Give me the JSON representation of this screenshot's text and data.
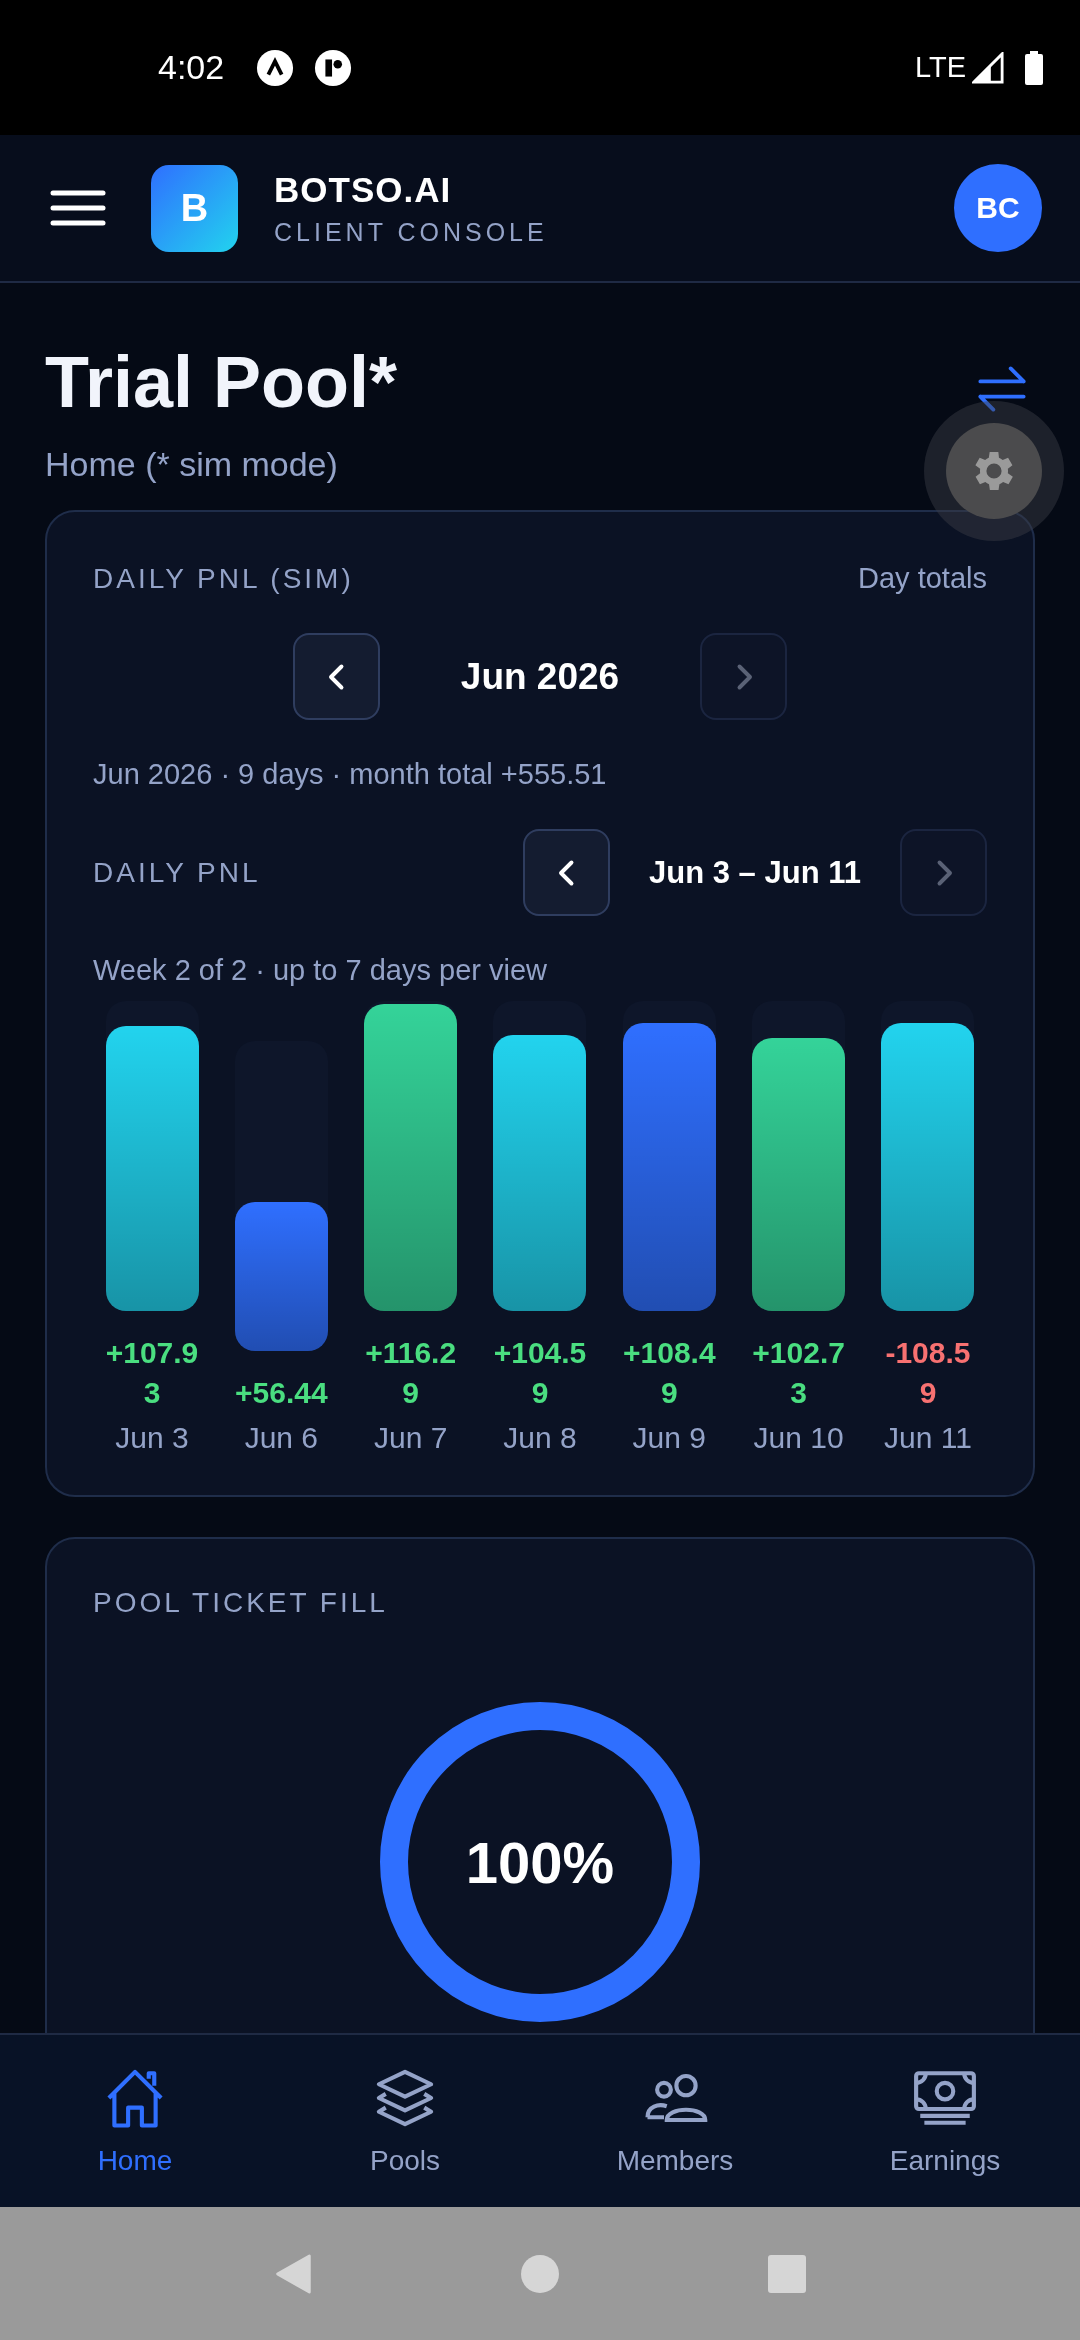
{
  "status_bar": {
    "time": "4:02",
    "network": "LTE"
  },
  "header": {
    "logo_letter": "B",
    "brand": "BOTSO.AI",
    "subtitle": "CLIENT CONSOLE",
    "avatar": "BC"
  },
  "page": {
    "title": "Trial Pool*",
    "subtitle": "Home (* sim mode)"
  },
  "pnl_card": {
    "title": "DAILY PNL (SIM)",
    "note": "Day totals",
    "month_nav": {
      "label": "Jun 2026",
      "prev_disabled": false,
      "next_disabled": true
    },
    "summary": "Jun 2026 · 9 days · month total +555.51",
    "week_nav": {
      "title": "DAILY PNL",
      "label": "Jun 3 – Jun 11",
      "prev_disabled": false,
      "next_disabled": true
    },
    "caption": "Week 2 of 2 · up to 7 days per view",
    "days": [
      {
        "label": "Jun 3",
        "value": "+107.93",
        "loss": false,
        "color": "#22d3ee",
        "level": 0.92
      },
      {
        "label": "Jun 6",
        "value": "+56.44",
        "loss": false,
        "color": "#2f6fff",
        "level": 0.48
      },
      {
        "label": "Jun 7",
        "value": "+116.29",
        "loss": false,
        "color": "#34d399",
        "level": 0.99
      },
      {
        "label": "Jun 8",
        "value": "+104.59",
        "loss": false,
        "color": "#22d3ee",
        "level": 0.89
      },
      {
        "label": "Jun 9",
        "value": "+108.49",
        "loss": false,
        "color": "#2f6fff",
        "level": 0.93
      },
      {
        "label": "Jun 10",
        "value": "+102.73",
        "loss": false,
        "color": "#34d399",
        "level": 0.88
      },
      {
        "label": "Jun 11",
        "value": "-108.59",
        "loss": true,
        "color": "#22d3ee",
        "level": 0.93
      }
    ]
  },
  "fill_card": {
    "title": "POOL TICKET FILL",
    "reading": "100%",
    "level": 1
  },
  "bottom_nav": [
    {
      "kind": "home",
      "label": "Home",
      "selected": true
    },
    {
      "kind": "pools",
      "label": "Pools",
      "selected": false
    },
    {
      "kind": "members",
      "label": "Members",
      "selected": false
    },
    {
      "kind": "earnings",
      "label": "Earnings",
      "selected": false
    }
  ]
}
